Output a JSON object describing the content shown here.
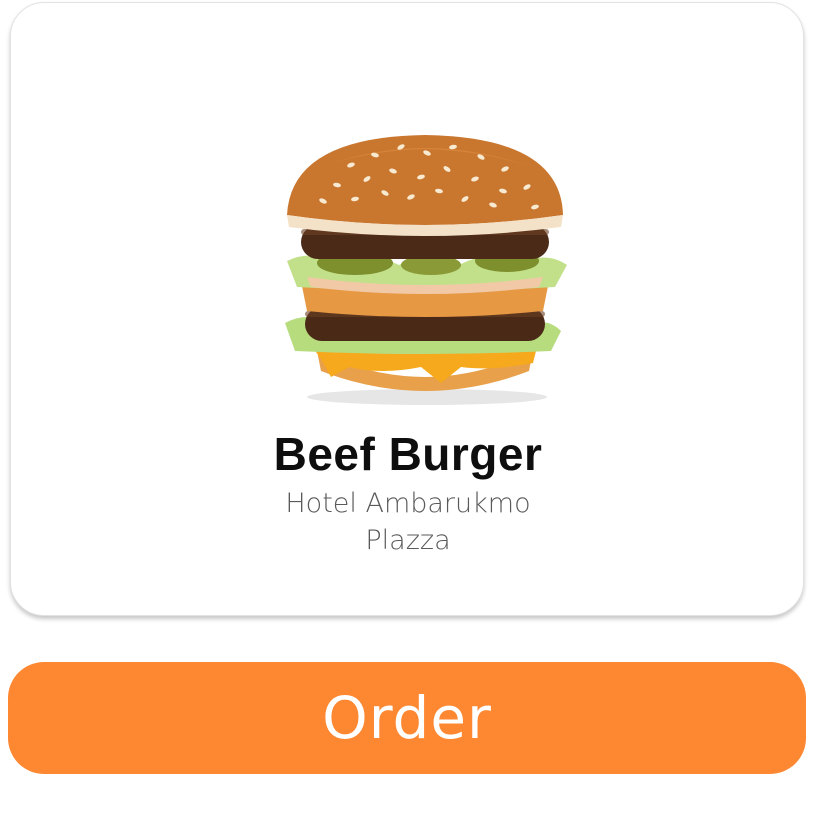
{
  "product": {
    "name": "Beef Burger",
    "location": "Hotel Ambarukmo Plazza",
    "image": "burger-image"
  },
  "actions": {
    "order_label": "Order"
  },
  "colors": {
    "accent": "#fe8731",
    "card_background": "#ffffff",
    "title_text": "#0e0e0e",
    "subtitle_text": "#5a5a5a"
  }
}
